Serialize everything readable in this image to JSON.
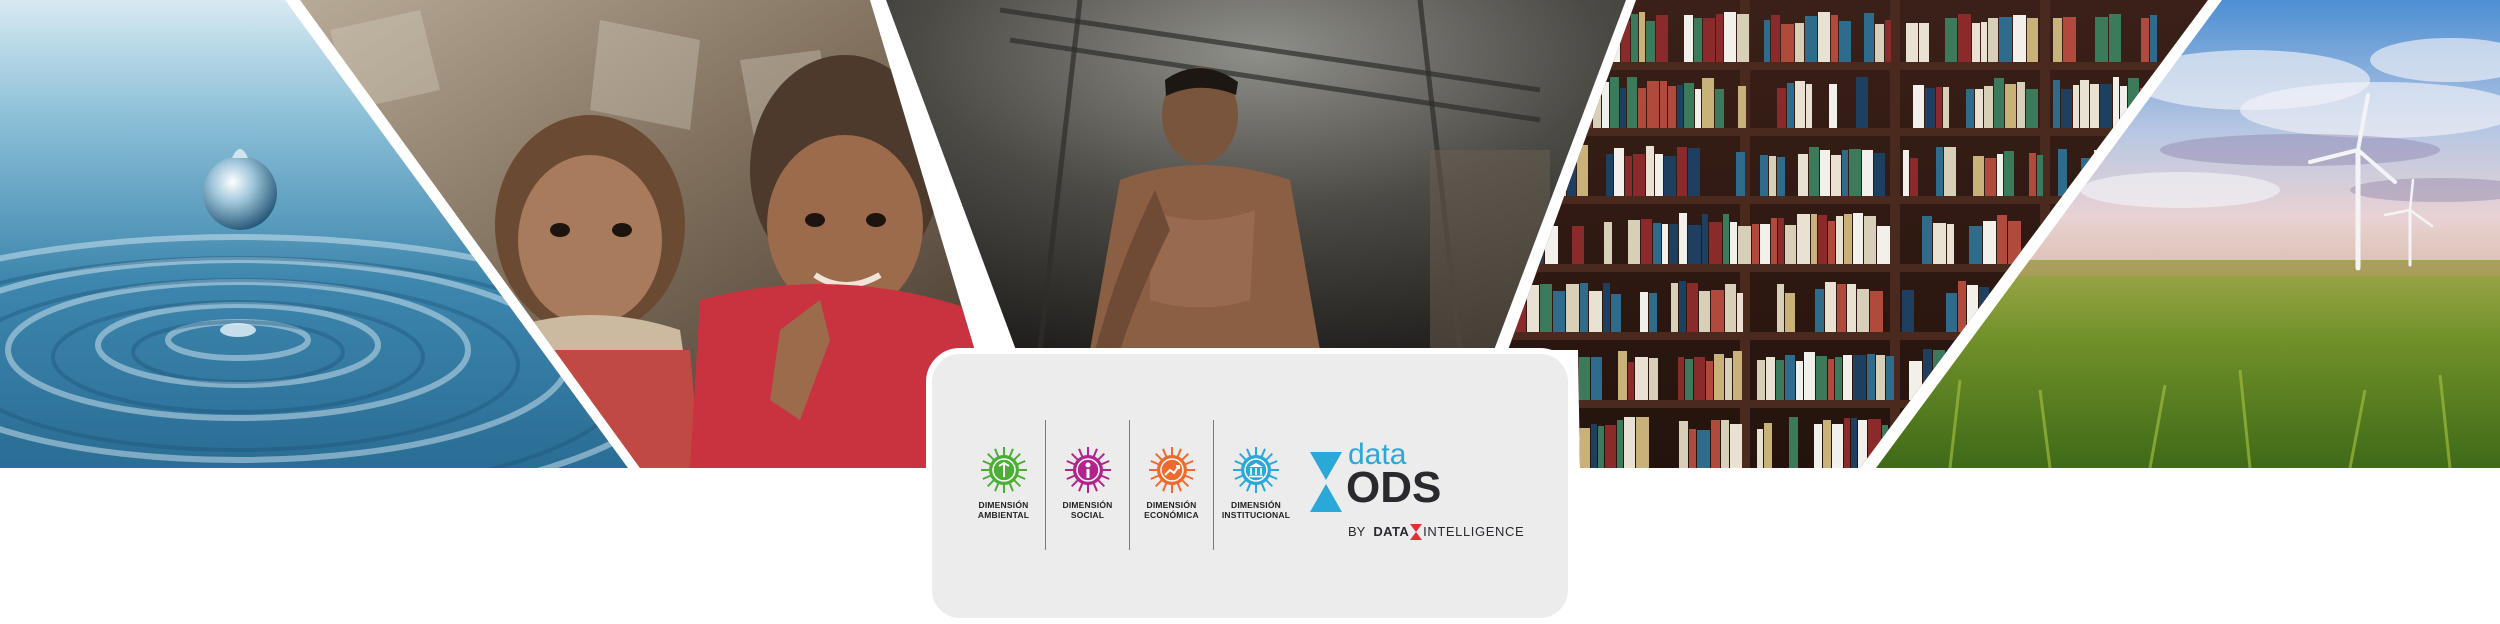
{
  "panels": [
    {
      "name": "water-drop-photo"
    },
    {
      "name": "children-photo"
    },
    {
      "name": "worker-photo"
    },
    {
      "name": "bookshelf-photo"
    },
    {
      "name": "wind-turbines-photo"
    }
  ],
  "dimensions": [
    {
      "label_line1": "DIMENSIÓN",
      "label_line2": "AMBIENTAL",
      "color": "#4caf35",
      "icon": "environment-icon"
    },
    {
      "label_line1": "DIMENSIÓN",
      "label_line2": "SOCIAL",
      "color": "#b2248c",
      "icon": "social-icon"
    },
    {
      "label_line1": "DIMENSIÓN",
      "label_line2": "ECONÓMICA",
      "color": "#ef6a2c",
      "icon": "economic-icon"
    },
    {
      "label_line1": "DIMENSIÓN",
      "label_line2": "INSTITUCIONAL",
      "color": "#2aa8d8",
      "icon": "institutional-icon"
    }
  ],
  "brand": {
    "word_data": "data",
    "word_ods": "ODS",
    "byline_by": "BY",
    "byline_company_part1": "DATA",
    "byline_company_part2": "INTELLIGENCE",
    "accent_blue": "#2aa8d8",
    "accent_red": "#e42c36",
    "dark": "#2a2a2e"
  }
}
